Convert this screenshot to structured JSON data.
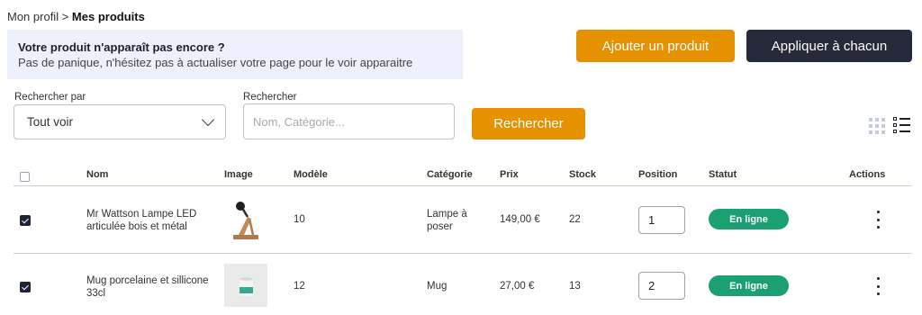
{
  "breadcrumb": {
    "parent": "Mon profil",
    "separator": ">",
    "current": "Mes produits"
  },
  "notice": {
    "title": "Votre produit n'apparaît pas encore ?",
    "text": "Pas de panique, n'hésitez pas à actualiser votre page pour le voir apparaitre"
  },
  "buttons": {
    "add_product": "Ajouter un produit",
    "apply_all": "Appliquer à chacun",
    "search": "Rechercher"
  },
  "filters": {
    "search_by_label": "Rechercher par",
    "search_by_value": "Tout voir",
    "search_label": "Rechercher",
    "search_placeholder": "Nom, Catégorie..."
  },
  "table": {
    "columns": [
      "Nom",
      "Image",
      "Modèle",
      "Catégorie",
      "Prix",
      "Stock",
      "Position",
      "Statut",
      "Actions"
    ],
    "rows": [
      {
        "checked": true,
        "name": "Mr Wattson Lampe LED articulée bois et métal",
        "image": "lamp-image",
        "model": "10",
        "category": "Lampe à poser",
        "price": "149,00 €",
        "stock": "22",
        "position": "1",
        "status": "En ligne"
      },
      {
        "checked": true,
        "name": "Mug porcelaine et sillicone 33cl",
        "image": "mug-image",
        "model": "12",
        "category": "Mug",
        "price": "27,00 €",
        "stock": "13",
        "position": "2",
        "status": "En ligne"
      }
    ]
  },
  "colors": {
    "accent": "#e69100",
    "dark": "#262a3a",
    "status_online": "#1aa071",
    "notice_bg": "#eef1fb"
  },
  "icons": [
    "chevron-down-icon",
    "grid-view-icon",
    "list-view-icon",
    "more-vertical-icon"
  ]
}
